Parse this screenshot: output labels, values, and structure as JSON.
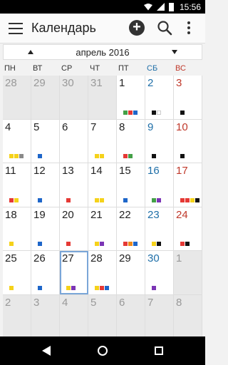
{
  "status": {
    "time": "15:56"
  },
  "app": {
    "title": "Календарь"
  },
  "month": {
    "label": "апрель 2016"
  },
  "weekdays": [
    "ПН",
    "ВТ",
    "СР",
    "ЧТ",
    "ПТ",
    "СБ",
    "ВС"
  ],
  "colors": {
    "green": "#43a047",
    "red": "#e53935",
    "blue": "#1e66c9",
    "black": "#111111",
    "yellow": "#f5d21a",
    "gray": "#8a8a8a",
    "purple": "#7b35b5",
    "orange": "#ef8a1a",
    "white": "#ffffff"
  },
  "days": [
    {
      "n": "28",
      "other": true,
      "ev": []
    },
    {
      "n": "29",
      "other": true,
      "ev": []
    },
    {
      "n": "30",
      "other": true,
      "ev": []
    },
    {
      "n": "31",
      "other": true,
      "ev": []
    },
    {
      "n": "1",
      "ev": [
        "green",
        "red",
        "blue"
      ]
    },
    {
      "n": "2",
      "ev": [
        "black",
        "white"
      ]
    },
    {
      "n": "3",
      "ev": [
        "black"
      ]
    },
    {
      "n": "4",
      "ev": [
        "yellow",
        "yellow",
        "gray"
      ]
    },
    {
      "n": "5",
      "ev": [
        "blue"
      ]
    },
    {
      "n": "6",
      "ev": []
    },
    {
      "n": "7",
      "ev": [
        "yellow",
        "yellow"
      ]
    },
    {
      "n": "8",
      "ev": [
        "red",
        "green"
      ]
    },
    {
      "n": "9",
      "ev": [
        "black"
      ]
    },
    {
      "n": "10",
      "ev": [
        "black"
      ]
    },
    {
      "n": "11",
      "ev": [
        "red",
        "yellow"
      ]
    },
    {
      "n": "12",
      "ev": [
        "blue"
      ]
    },
    {
      "n": "13",
      "ev": [
        "red"
      ]
    },
    {
      "n": "14",
      "ev": [
        "yellow",
        "yellow"
      ]
    },
    {
      "n": "15",
      "ev": [
        "blue"
      ]
    },
    {
      "n": "16",
      "ev": [
        "green",
        "purple"
      ]
    },
    {
      "n": "17",
      "ev": [
        "red",
        "red",
        "yellow",
        "black"
      ]
    },
    {
      "n": "18",
      "ev": [
        "yellow"
      ]
    },
    {
      "n": "19",
      "ev": [
        "blue"
      ]
    },
    {
      "n": "20",
      "ev": [
        "red"
      ]
    },
    {
      "n": "21",
      "ev": [
        "yellow",
        "purple"
      ]
    },
    {
      "n": "22",
      "ev": [
        "red",
        "orange",
        "blue"
      ]
    },
    {
      "n": "23",
      "ev": [
        "yellow",
        "black"
      ]
    },
    {
      "n": "24",
      "ev": [
        "red",
        "black"
      ]
    },
    {
      "n": "25",
      "ev": [
        "yellow"
      ]
    },
    {
      "n": "26",
      "ev": [
        "blue"
      ]
    },
    {
      "n": "27",
      "today": true,
      "ev": [
        "yellow",
        "purple"
      ]
    },
    {
      "n": "28",
      "ev": [
        "yellow",
        "red",
        "blue"
      ]
    },
    {
      "n": "29",
      "ev": []
    },
    {
      "n": "30",
      "ev": [
        "purple"
      ]
    },
    {
      "n": "1",
      "other": true,
      "ev": []
    },
    {
      "n": "2",
      "other": true,
      "ev": []
    },
    {
      "n": "3",
      "other": true,
      "ev": []
    },
    {
      "n": "4",
      "other": true,
      "ev": []
    },
    {
      "n": "5",
      "other": true,
      "ev": []
    },
    {
      "n": "6",
      "other": true,
      "ev": []
    },
    {
      "n": "7",
      "other": true,
      "ev": []
    },
    {
      "n": "8",
      "other": true,
      "ev": []
    }
  ],
  "icons": {
    "menu": "menu-icon",
    "add": "add-icon",
    "search": "search-icon",
    "more": "more-vert-icon",
    "prev": "chevron-up-icon",
    "next": "chevron-down-icon",
    "back": "back-icon",
    "home": "home-icon",
    "recents": "recents-icon"
  }
}
